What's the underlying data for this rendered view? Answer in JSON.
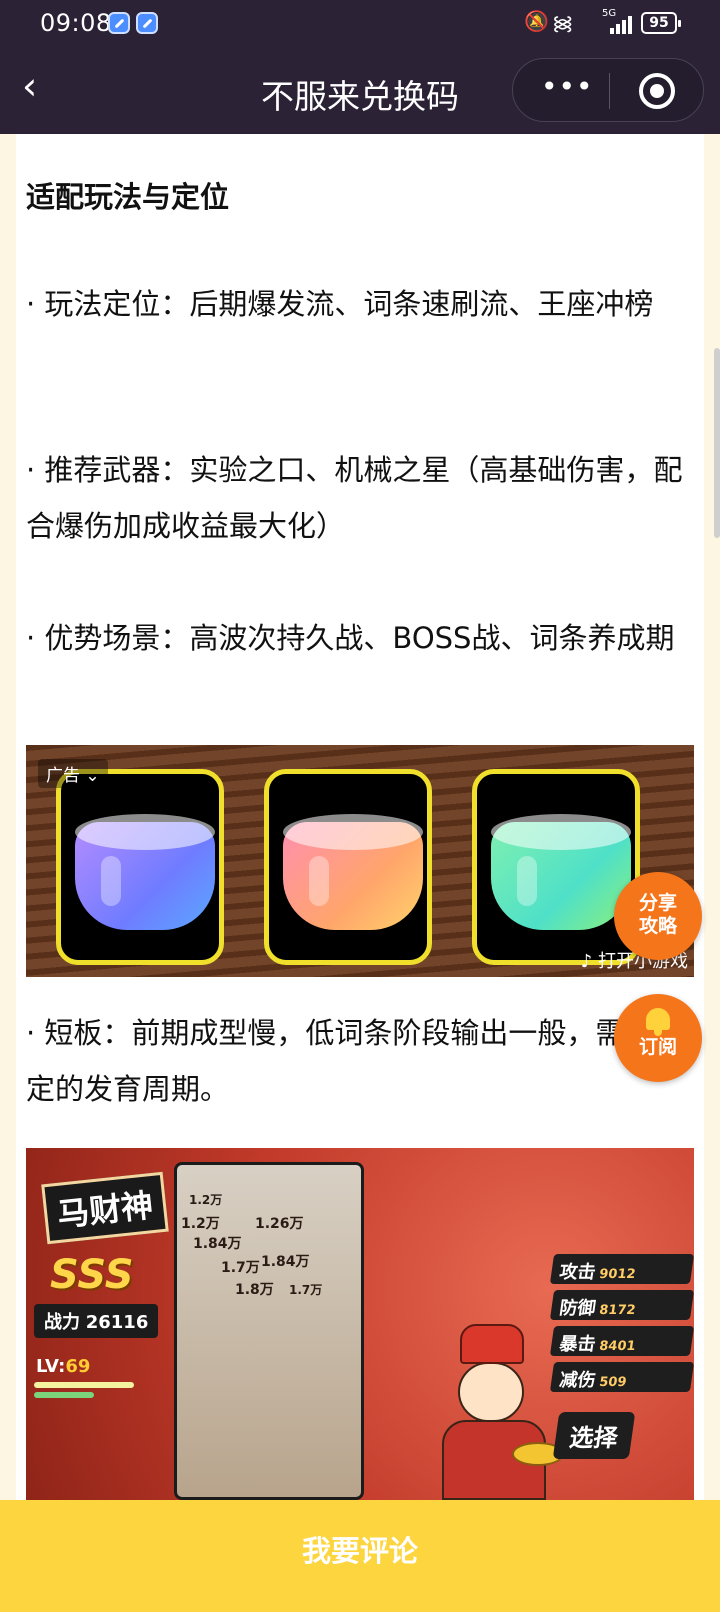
{
  "status_bar": {
    "time": "09:08",
    "network": "5G",
    "battery": "95"
  },
  "nav": {
    "title": "不服来兑换码"
  },
  "article": {
    "heading": "适配玩法与定位",
    "para_1": "· 玩法定位：后期爆发流、词条速刷流、王座冲榜",
    "para_2": "· 推荐武器：实验之口、机械之星（高基础伤害，配合爆伤加成收益最大化）",
    "para_3": "· 优势场景：高波次持久战、BOSS战、词条养成期",
    "para_4": "· 短板：前期成型慢，低词条阶段输出一般，需要一定的发育周期。"
  },
  "ad": {
    "label": "广告",
    "open_text": "打开小游戏",
    "colors": [
      "#8a7bff",
      "#ff9b6b",
      "#5fe6a8"
    ]
  },
  "floating": {
    "share": "分享攻略",
    "subscribe": "订阅"
  },
  "game_image": {
    "hero_name": "马财神",
    "rank": "SSS",
    "power_label": "战力",
    "power_value": "26116",
    "lv_label": "LV:",
    "lv_value": "69",
    "damage_numbers": [
      "1.2万",
      "1.2万",
      "1.26万",
      "1.84万",
      "1.7万",
      "1.84万",
      "1.8万",
      "1.7万"
    ],
    "stats": [
      {
        "label": "攻击",
        "value": "9012"
      },
      {
        "label": "防御",
        "value": "8172"
      },
      {
        "label": "暴击",
        "value": "8401"
      },
      {
        "label": "减伤",
        "value": "509"
      }
    ],
    "choose": "选择"
  },
  "bottom": {
    "comment_button": "我要评论"
  }
}
